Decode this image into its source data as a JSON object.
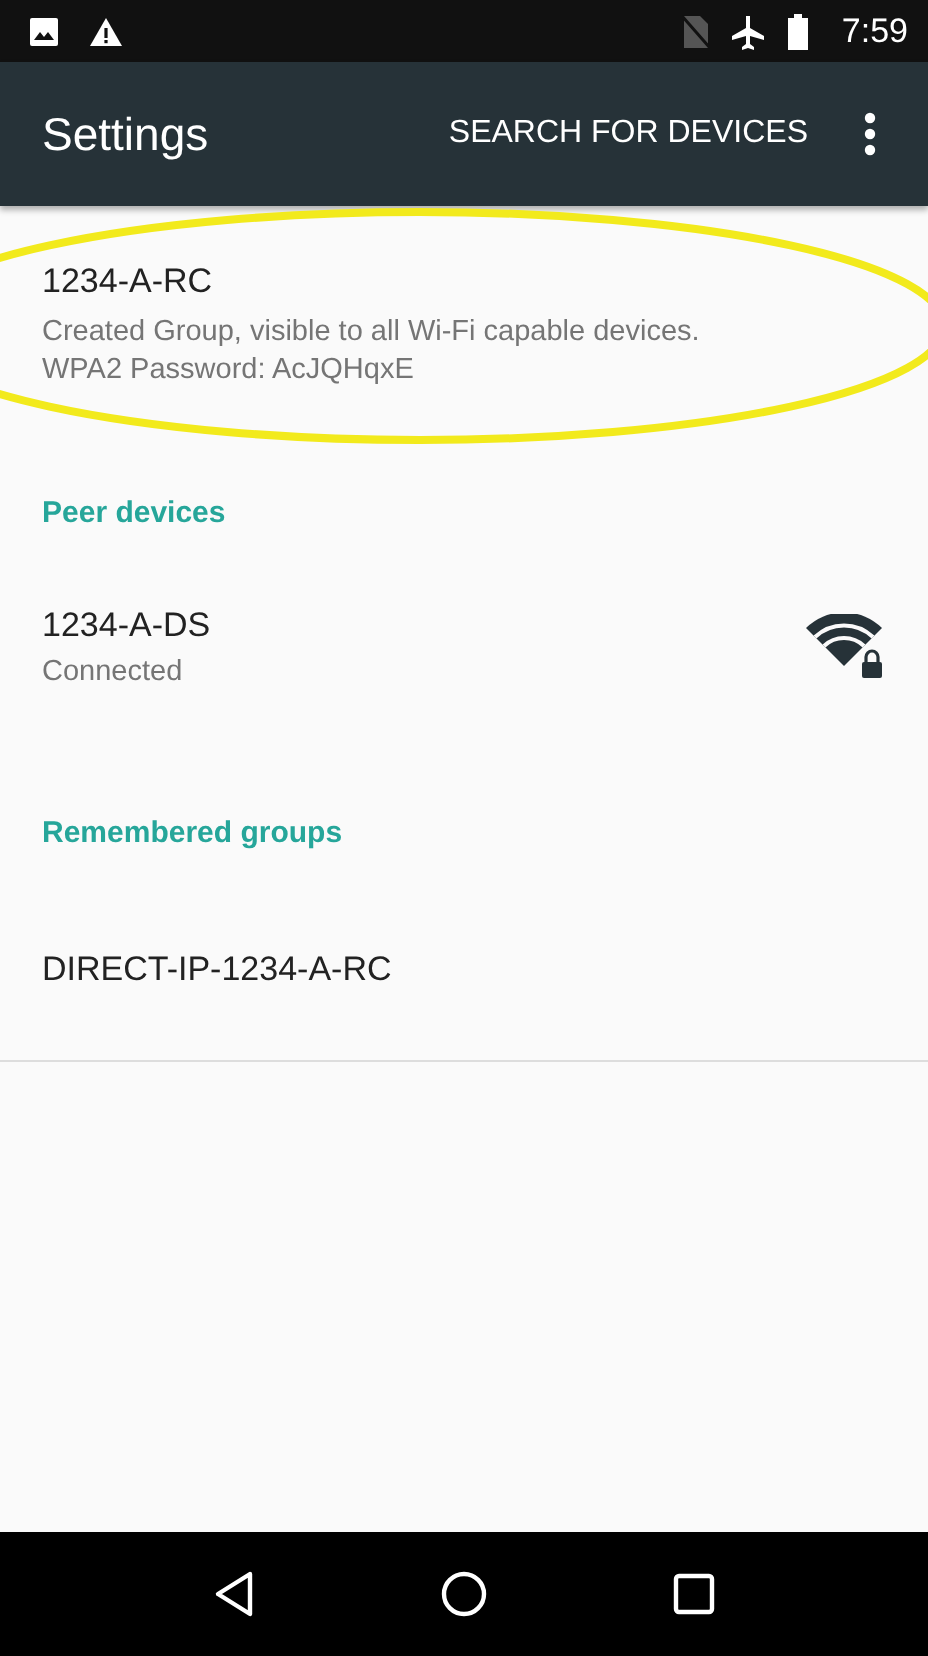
{
  "status_bar": {
    "time": "7:59"
  },
  "app_bar": {
    "title": "Settings",
    "action": "SEARCH FOR DEVICES"
  },
  "my_device": {
    "name": "1234-A-RC",
    "summary": "Created Group, visible to all Wi-Fi capable devices.",
    "password": "WPA2 Password: AcJQHqxE",
    "highlighted": true
  },
  "sections": [
    {
      "header": "Peer devices",
      "items": [
        {
          "name": "1234-A-DS",
          "status": "Connected",
          "kind": "peer"
        }
      ]
    },
    {
      "header": "Remembered groups",
      "items": [
        {
          "name": "DIRECT-IP-1234-A-RC",
          "kind": "group"
        }
      ]
    }
  ]
}
